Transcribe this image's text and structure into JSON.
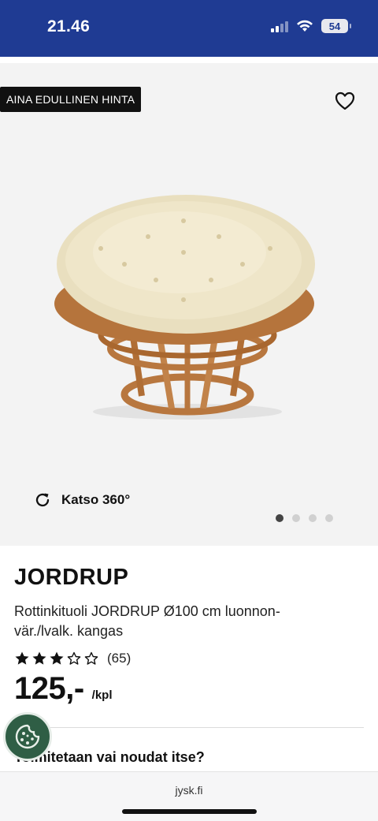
{
  "status_bar": {
    "time": "21.46",
    "battery": "54"
  },
  "hero": {
    "badge": "AINA EDULLINEN HINTA",
    "rotate_label": "Katso 360°",
    "slides_total": 4,
    "active_slide": 1
  },
  "product": {
    "brand": "JORDRUP",
    "description": "Rottinkituoli JORDRUP Ø100 cm luonnon-vär./lvalk. kangas",
    "rating": 3,
    "rating_max": 5,
    "review_count": "(65)",
    "price": "125,-",
    "unit": "/kpl"
  },
  "delivery": {
    "question": "Toimitetaan vai noudat itse?"
  },
  "browser": {
    "url": "jysk.fi"
  },
  "colors": {
    "header": "#1f3b93",
    "cookie": "#2f5e45"
  }
}
